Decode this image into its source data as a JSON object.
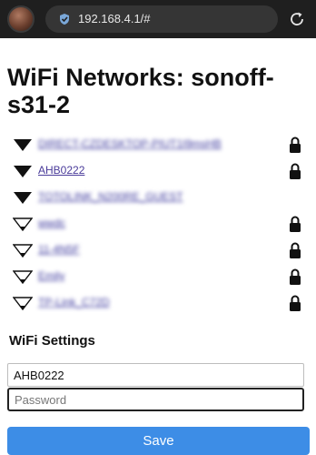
{
  "browser": {
    "url": "192.168.4.1/#",
    "icons": {
      "avatar": "profile-avatar",
      "site": "site-info-icon",
      "reload": "reload-icon"
    }
  },
  "page": {
    "title": "WiFi Networks: sonoff-s31-2",
    "networks": [
      {
        "ssid": "DIRECT-CZDESKTOP-PIUT1I9msHB",
        "signal": "strong",
        "secured": true,
        "obscured": true
      },
      {
        "ssid": "AHB0222",
        "signal": "strong",
        "secured": true,
        "obscured": false
      },
      {
        "ssid": "TOTOLINK_N200RE_GUEST",
        "signal": "strong",
        "secured": false,
        "obscured": true
      },
      {
        "ssid": "wwdc",
        "signal": "weak",
        "secured": true,
        "obscured": true
      },
      {
        "ssid": "11-4N5F",
        "signal": "weak",
        "secured": true,
        "obscured": true
      },
      {
        "ssid": "Emily",
        "signal": "weak",
        "secured": true,
        "obscured": true
      },
      {
        "ssid": "TP-Link_C72D",
        "signal": "weak",
        "secured": true,
        "obscured": true
      }
    ],
    "settings": {
      "heading": "WiFi Settings",
      "ssid_value": "AHB0222",
      "password_placeholder": "Password",
      "save_label": "Save"
    }
  },
  "colors": {
    "link": "#4a3b9a",
    "button": "#3d8de6",
    "topbar": "#1f1f1f"
  }
}
